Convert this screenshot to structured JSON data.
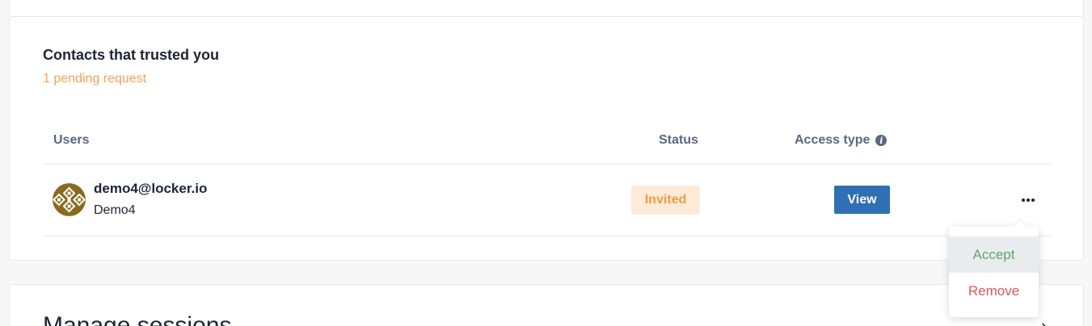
{
  "trusted_section": {
    "title": "Contacts that trusted you",
    "subtitle": "1 pending request",
    "columns": {
      "users": "Users",
      "status": "Status",
      "access_type": "Access type",
      "info_icon": "i"
    },
    "rows": [
      {
        "email": "demo4@locker.io",
        "name": "Demo4",
        "status": "Invited",
        "access_button": "View",
        "more_icon": "more-horizontal-icon"
      }
    ]
  },
  "row_menu": {
    "items": [
      {
        "label": "Accept",
        "color": "#5ea865"
      },
      {
        "label": "Remove",
        "color": "#e0545a"
      }
    ]
  },
  "sessions_section": {
    "title": "Manage sessions",
    "chevron": "›"
  },
  "colors": {
    "pending": "#f0a258",
    "badge_bg": "#fdebd8",
    "badge_text": "#ef9b43",
    "primary": "#2f6fb4",
    "avatar": "#8a6a1f"
  }
}
